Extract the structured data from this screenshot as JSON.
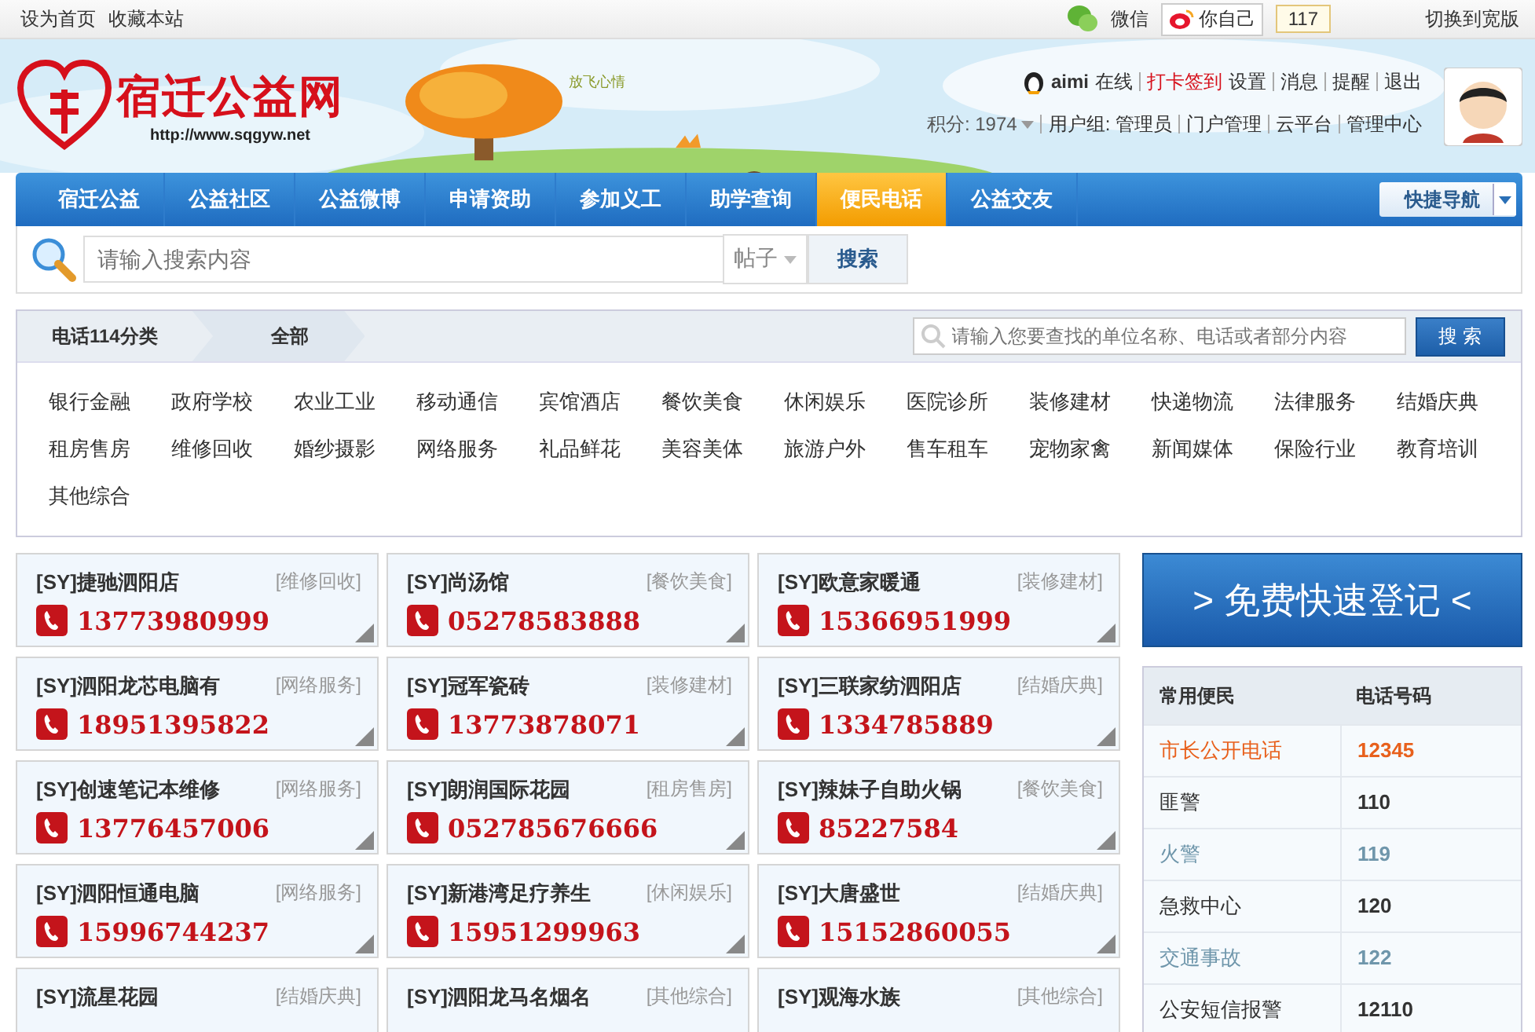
{
  "top_bar": {
    "links": [
      "设为首页",
      "收藏本站"
    ],
    "wechat": "微信",
    "weibo": "你自己",
    "weibo_count": "117",
    "switch": "切换到宽版"
  },
  "header": {
    "logo_title": "宿迁公益网",
    "logo_url": "http://www.sqgyw.net",
    "slogan": "放飞心情",
    "user": {
      "name": "aimi",
      "status": "在线",
      "checkin": "打卡签到",
      "links": [
        "设置",
        "消息",
        "提醒",
        "退出"
      ],
      "points": "积分: 1974",
      "group": "用户组: 管理员",
      "admin_links": [
        "门户管理",
        "云平台",
        "管理中心"
      ]
    }
  },
  "nav": {
    "items": [
      {
        "label": "宿迁公益",
        "selected": false
      },
      {
        "label": "公益社区",
        "selected": false
      },
      {
        "label": "公益微博",
        "selected": false
      },
      {
        "label": "申请资助",
        "selected": false
      },
      {
        "label": "参加义工",
        "selected": false
      },
      {
        "label": "助学查询",
        "selected": false
      },
      {
        "label": "便民电话",
        "selected": true
      },
      {
        "label": "公益交友",
        "selected": false
      }
    ],
    "quick_nav": "快捷导航"
  },
  "search": {
    "placeholder": "请输入搜索内容",
    "type": "帖子",
    "button": "搜索"
  },
  "category_panel": {
    "breadcrumb": [
      "电话114分类",
      "全部"
    ],
    "search_placeholder": "请输入您要查找的单位名称、电话或者部分内容",
    "search_button": "搜 索",
    "categories": [
      "银行金融",
      "政府学校",
      "农业工业",
      "移动通信",
      "宾馆酒店",
      "餐饮美食",
      "休闲娱乐",
      "医院诊所",
      "装修建材",
      "快递物流",
      "法律服务",
      "结婚庆典",
      "租房售房",
      "维修回收",
      "婚纱摄影",
      "网络服务",
      "礼品鲜花",
      "美容美体",
      "旅游户外",
      "售车租车",
      "宠物家禽",
      "新闻媒体",
      "保险行业",
      "教育培训",
      "其他综合"
    ]
  },
  "listings": [
    {
      "name": "[SY]捷驰泗阳店",
      "tag": "[维修回收]",
      "phone": "13773980999"
    },
    {
      "name": "[SY]尚汤馆",
      "tag": "[餐饮美食]",
      "phone": "05278583888"
    },
    {
      "name": "[SY]欧意家暖通",
      "tag": "[装修建材]",
      "phone": "15366951999"
    },
    {
      "name": "[SY]泗阳龙芯电脑有",
      "tag": "[网络服务]",
      "phone": "18951395822"
    },
    {
      "name": "[SY]冠军瓷砖",
      "tag": "[装修建材]",
      "phone": "13773878071"
    },
    {
      "name": "[SY]三联家纺泗阳店",
      "tag": "[结婚庆典]",
      "phone": "1334785889"
    },
    {
      "name": "[SY]创速笔记本维修",
      "tag": "[网络服务]",
      "phone": "13776457006"
    },
    {
      "name": "[SY]朗润国际花园",
      "tag": "[租房售房]",
      "phone": "052785676666"
    },
    {
      "name": "[SY]辣妹子自助火锅",
      "tag": "[餐饮美食]",
      "phone": "85227584"
    },
    {
      "name": "[SY]泗阳恒通电脑",
      "tag": "[网络服务]",
      "phone": "15996744237"
    },
    {
      "name": "[SY]新港湾足疗养生",
      "tag": "[休闲娱乐]",
      "phone": "15951299963"
    },
    {
      "name": "[SY]大唐盛世",
      "tag": "[结婚庆典]",
      "phone": "15152860055"
    },
    {
      "name": "[SY]流星花园",
      "tag": "[结婚庆典]"
    },
    {
      "name": "[SY]泗阳龙马名烟名",
      "tag": "[其他综合]"
    },
    {
      "name": "[SY]观海水族",
      "tag": "[其他综合]"
    }
  ],
  "register_button": "> 免费快速登记 <",
  "common_numbers": {
    "columns": [
      "常用便民",
      "电话号码"
    ],
    "rows": [
      {
        "name": "市长公开电话",
        "number": "12345",
        "color": "#e8601c"
      },
      {
        "name": "匪警",
        "number": "110",
        "color": "#333333"
      },
      {
        "name": "火警",
        "number": "119",
        "color": "#6f96ab"
      },
      {
        "name": "急救中心",
        "number": "120",
        "color": "#333333"
      },
      {
        "name": "交通事故",
        "number": "122",
        "color": "#6f96ab"
      },
      {
        "name": "公安短信报警",
        "number": "12110",
        "color": "#333333"
      }
    ]
  }
}
